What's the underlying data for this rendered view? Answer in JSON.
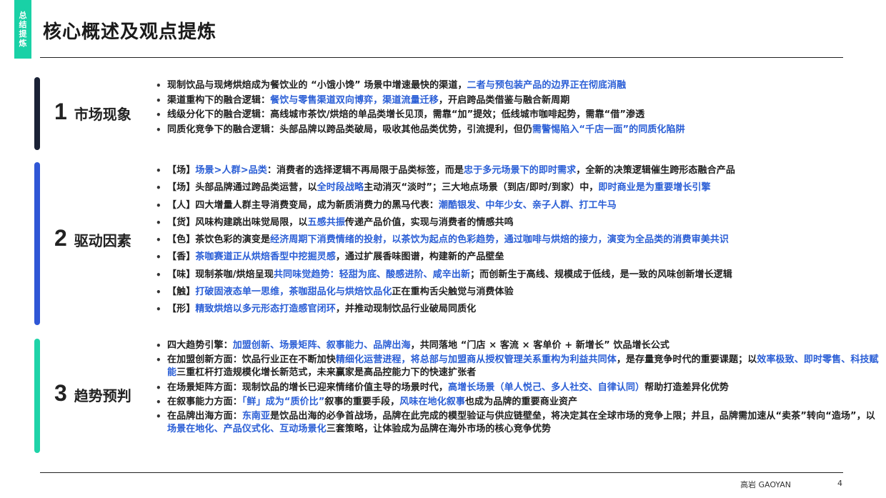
{
  "sidebar_tag": "总结提炼",
  "title": "核心概述及观点提炼",
  "footer": {
    "brand": "高岩 GAOYAN",
    "page": "4"
  },
  "colors": {
    "tag": "#19d1a6",
    "bar1": "#1b2236",
    "bar2": "#2f57d6",
    "bar3": "#1fd3a8",
    "highlight": "#2a5ed6"
  },
  "sections": [
    {
      "num": "1",
      "name": "市场现象",
      "bullets": [
        {
          "segments": [
            {
              "t": "现制饮品与现烤烘焙成为餐饮业的 “小饿小馋” 场景中增速最快的渠道，"
            },
            {
              "t": "二者与预包装产品的边界正在彻底消融",
              "hl": true
            }
          ]
        },
        {
          "segments": [
            {
              "t": "渠道重构下的融合逻辑："
            },
            {
              "t": "餐饮与零售渠道双向博弈，渠道流量迁移",
              "hl": true
            },
            {
              "t": "，开启跨品类借鉴与融合新周期"
            }
          ]
        },
        {
          "segments": [
            {
              "t": "线级分化下的融合逻辑：高线城市茶饮/烘焙的单品类增长见顶，需靠“加”提效；低线城市咖啡起势，需靠“借”渗透"
            }
          ]
        },
        {
          "segments": [
            {
              "t": "同质化竞争下的融合逻辑：头部品牌以跨品类破局，吸收其他品类优势，引流提利，但仍"
            },
            {
              "t": "需警惕陷入“千店一面”的同质化陷阱",
              "hl": true
            }
          ]
        }
      ]
    },
    {
      "num": "2",
      "name": "驱动因素",
      "bullets": [
        {
          "segments": [
            {
              "t": "【场】"
            },
            {
              "t": "场景>人群>品类",
              "hl": true
            },
            {
              "t": "：消费者的选择逻辑不再局限于品类标签，而是"
            },
            {
              "t": "忠于多元场景下的即时需求",
              "hl": true
            },
            {
              "t": "，全新的决策逻辑催生跨形态融合产品"
            }
          ]
        },
        {
          "segments": [
            {
              "t": "【场】头部品牌通过跨品类运营，以"
            },
            {
              "t": "全时段战略",
              "hl": true
            },
            {
              "t": "主动消灭“淡时”；三大地点场景（到店/即时/到家）中，"
            },
            {
              "t": "即时商业是为重要增长引擎",
              "hl": true
            }
          ]
        },
        {
          "segments": [
            {
              "t": "【人】四大增量人群主导消费变局，成为新质消费力的黑马代表："
            },
            {
              "t": "潮酷银发、中年少女、亲子人群、打工牛马",
              "hl": true
            }
          ]
        },
        {
          "segments": [
            {
              "t": "【货】风味构建跳出味觉局限，以"
            },
            {
              "t": "五感共振",
              "hl": true
            },
            {
              "t": "传递产品价值，实现与消费者的情感共鸣"
            }
          ]
        },
        {
          "segments": [
            {
              "t": "【色】茶饮色彩的演变是"
            },
            {
              "t": "经济周期下消费情绪的投射，以茶饮为起点的色彩趋势，通过咖啡与烘焙的接力，演变为全品类的消费审美共识",
              "hl": true
            }
          ]
        },
        {
          "segments": [
            {
              "t": "【香】"
            },
            {
              "t": "茶咖赛道正从烘焙香型中挖掘灵感",
              "hl": true
            },
            {
              "t": "，通过扩展香味图谱，构建新的产品壁垒"
            }
          ]
        },
        {
          "segments": [
            {
              "t": "【味】现制茶咖/烘焙呈现"
            },
            {
              "t": "共同味觉趋势：轻甜为底、酸感进阶、咸辛出新",
              "hl": true
            },
            {
              "t": "；而创新生于高线、规模成于低线，是一致的风味创新增长逻辑"
            }
          ]
        },
        {
          "segments": [
            {
              "t": "【触】"
            },
            {
              "t": "打破固液态单一思维，茶咖甜品化与烘焙饮品化",
              "hl": true
            },
            {
              "t": "正在重构舌尖触觉与消费体验"
            }
          ]
        },
        {
          "segments": [
            {
              "t": "【形】"
            },
            {
              "t": "精致烘焙以多元形态打造感官闭环",
              "hl": true
            },
            {
              "t": "，并推动现制饮品行业破局同质化"
            }
          ]
        }
      ]
    },
    {
      "num": "3",
      "name": "趋势预判",
      "bullets": [
        {
          "segments": [
            {
              "t": "四大趋势引擎："
            },
            {
              "t": "加盟创新、场景矩阵、叙事能力、品牌出海",
              "hl": true
            },
            {
              "t": "，共同落地 “门店 × 客流 × 客单价 + 新增长” 饮品增长公式"
            }
          ]
        },
        {
          "wrap": true,
          "segments": [
            {
              "t": "在加盟创新方面：饮品行业正在不断加快"
            },
            {
              "t": "精细化运营进程，将总部与加盟商从授权管理关系重构为利益共同体",
              "hl": true
            },
            {
              "t": "，是存量竞争时代的重要课题；以"
            },
            {
              "t": "效率极致、即时零售、科技赋能",
              "hl": true
            },
            {
              "t": "三重杠杆打造规模化增长新范式，未来赢家是高品控能力下的快速扩张者"
            }
          ]
        },
        {
          "segments": [
            {
              "t": "在场景矩阵方面：现制饮品的增长已迎来情绪价值主导的场景时代，"
            },
            {
              "t": "高增长场景（单人悦己、多人社交、自律认同）",
              "hl": true
            },
            {
              "t": "帮助打造差异化优势"
            }
          ]
        },
        {
          "segments": [
            {
              "t": "在叙事能力方面："
            },
            {
              "t": "「鲜」成为“质价比”",
              "hl": true
            },
            {
              "t": "叙事的重要手段，"
            },
            {
              "t": "风味在地化叙事",
              "hl": true
            },
            {
              "t": "也成为品牌的重要商业资产"
            }
          ]
        },
        {
          "wrap": true,
          "segments": [
            {
              "t": "在品牌出海方面："
            },
            {
              "t": "东南亚",
              "hl": true
            },
            {
              "t": "是饮品出海的必争首战场，品牌在此完成的模型验证与供应链壁垒，将决定其在全球市场的竞争上限；并且，品牌需加速从“卖茶”转向“造场”，以"
            },
            {
              "t": "场景在地化、产品仪式化、互动场景化",
              "hl": true
            },
            {
              "t": "三套策略，让体验成为品牌在海外市场的核心竞争优势"
            }
          ]
        }
      ]
    }
  ]
}
